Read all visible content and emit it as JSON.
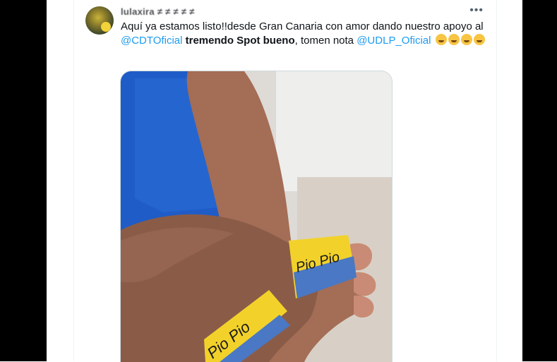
{
  "tweet": {
    "username": "lulaxira ≠ ≠ ≠ ≠ ≠",
    "more_label": "•••",
    "text_start": "Aquí ya estamos listo!!desde Gran Canaria con amor dando nuestro apoyo al ",
    "mention_1": "@CDTOficial",
    "bold_text": " tremendo Spot bueno",
    "text_mid": ", tomen nota ",
    "mention_2": "@UDLP_Oficial",
    "emojis": [
      "rolling-on-floor-laughing",
      "rolling-on-floor-laughing",
      "rolling-on-floor-laughing",
      "rolling-on-floor-laughing"
    ],
    "media": {
      "alt": "two arms wearing yellow and blue wristbands",
      "wristband_text_1": "Pio Pio",
      "wristband_text_2": "Pio Pio"
    }
  },
  "colors": {
    "link": "#1d9bf0",
    "text": "#0f1419",
    "wristband_yellow": "#f2d22a",
    "wristband_blue": "#4a78c4"
  }
}
